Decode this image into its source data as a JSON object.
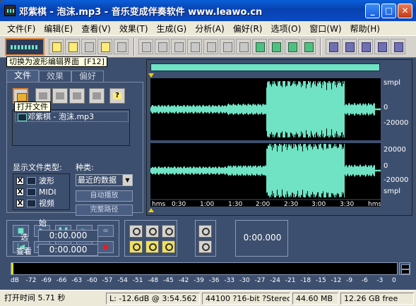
{
  "window": {
    "title": "邓紫棋 - 泡沫.mp3 - 音乐变成伴奏软件 www.leawo.cn",
    "min_glyph": "_",
    "max_glyph": "□",
    "close_glyph": "✕"
  },
  "menu": [
    {
      "label": "文件(F)"
    },
    {
      "label": "编辑(E)"
    },
    {
      "label": "查看(V)"
    },
    {
      "label": "效果(T)"
    },
    {
      "label": "生成(G)"
    },
    {
      "label": "分析(A)"
    },
    {
      "label": "偏好(R)"
    },
    {
      "label": "选项(O)"
    },
    {
      "label": "窗口(W)"
    },
    {
      "label": "帮助(H)"
    }
  ],
  "tooltips": {
    "wave_toggle": "切换为波形编辑界面  [F12]",
    "open_file": "打开文件"
  },
  "left_panel": {
    "tabs": [
      "文件",
      "效果",
      "偏好"
    ],
    "file_entry": "邓紫棋 - 泡沫.mp3",
    "type_label": "显示文件类型:",
    "kind_label": "种类:",
    "types": [
      {
        "label": "波形",
        "checked": "X"
      },
      {
        "label": "MIDI",
        "checked": "X"
      },
      {
        "label": "视频",
        "checked": "X"
      }
    ],
    "kind_selected": "最近的数据",
    "kind_arrow": "▼",
    "autoplay_label": "自动播放",
    "fullpath_label": "完整路径"
  },
  "wave": {
    "scale_unit_top": "smpl",
    "scale_zero_top": "0",
    "scale_neg_top": "-20000",
    "scale_pos_bottom": "20000",
    "scale_zero_bottom": "0",
    "scale_neg_bottom": "-20000",
    "scale_unit_bottom": "smpl",
    "ruler": [
      "hms",
      "0:30",
      "1:00",
      "1:30",
      "2:00",
      "2:30",
      "3:00",
      "3:30",
      "hms"
    ],
    "waveform_color": "#6fe3c4"
  },
  "transport": {
    "time_display": "0:00.000",
    "sel_header": "始",
    "sel_label": "选",
    "sel_value": "0:00.000",
    "view_label": "查看",
    "view_value": "0:00.000"
  },
  "meter": {
    "ticks": [
      "dB",
      "-72",
      "-69",
      "-66",
      "-63",
      "-60",
      "-57",
      "-54",
      "-51",
      "-48",
      "-45",
      "-42",
      "-39",
      "-36",
      "-33",
      "-30",
      "-27",
      "-24",
      "-21",
      "-18",
      "-15",
      "-12",
      "-9",
      "-6",
      "-3",
      "0"
    ]
  },
  "status": {
    "open_time": "打开时间  5.71 秒",
    "level": "L: -12.6dB @  3:54.562",
    "format": "44100 ?16-bit ?Stereo",
    "size": "44.60 MB",
    "free": "12.26 GB free"
  }
}
